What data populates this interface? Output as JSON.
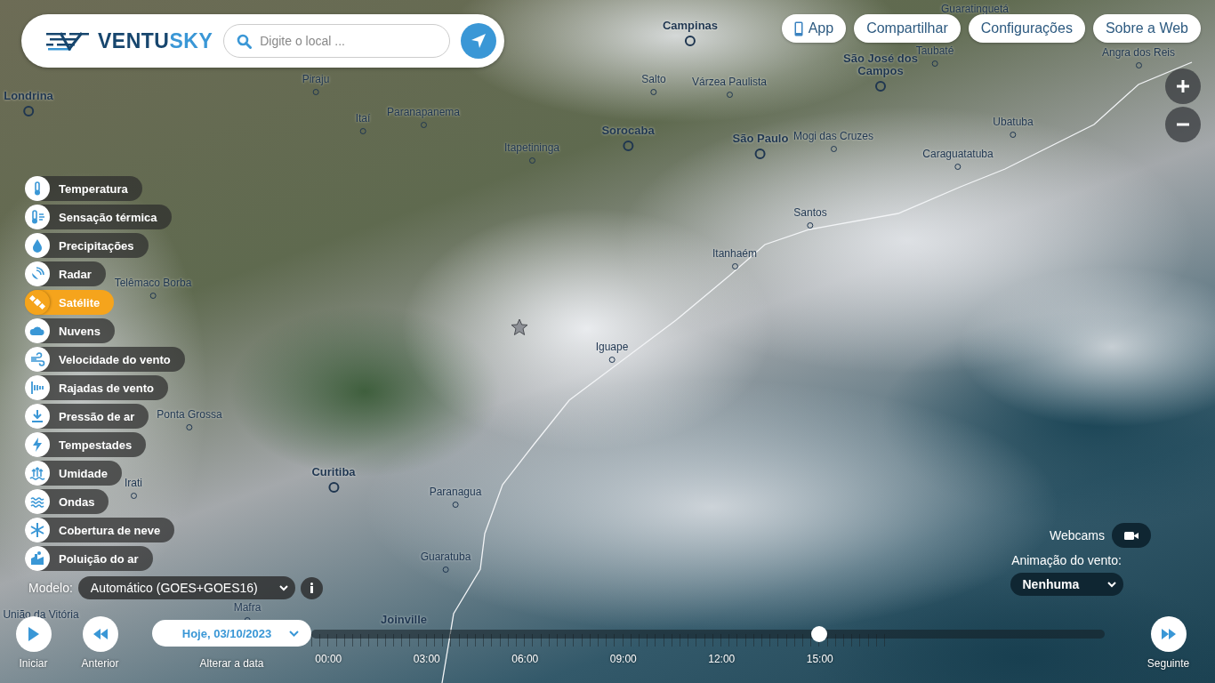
{
  "header": {
    "logo_dark": "VENTU",
    "logo_light": "SKY",
    "search": {
      "placeholder": "Digite o local ..."
    }
  },
  "top_buttons": [
    {
      "label": "App",
      "kind": "app"
    },
    {
      "label": "Compartilhar",
      "kind": "plain"
    },
    {
      "label": "Configurações",
      "kind": "plain"
    },
    {
      "label": "Sobre a Web",
      "kind": "plain"
    }
  ],
  "layers": [
    {
      "label": "Temperatura",
      "selected": false
    },
    {
      "label": "Sensação térmica",
      "selected": false
    },
    {
      "label": "Precipitações",
      "selected": false
    },
    {
      "label": "Radar",
      "selected": false
    },
    {
      "label": "Satélite",
      "selected": true
    },
    {
      "label": "Nuvens",
      "selected": false
    },
    {
      "label": "Velocidade do vento",
      "selected": false
    },
    {
      "label": "Rajadas de vento",
      "selected": false
    },
    {
      "label": "Pressão de ar",
      "selected": false
    },
    {
      "label": "Tempestades",
      "selected": false
    },
    {
      "label": "Umidade",
      "selected": false
    },
    {
      "label": "Ondas",
      "selected": false
    },
    {
      "label": "Cobertura de neve",
      "selected": false
    },
    {
      "label": "Poluição do ar",
      "selected": false
    }
  ],
  "model": {
    "label": "Modelo:",
    "value": "Automático (GOES+GOES16)"
  },
  "webcams": {
    "label": "Webcams"
  },
  "wind_animation": {
    "label": "Animação do vento:",
    "value": "Nenhuma"
  },
  "map": {
    "cities": [
      {
        "name": "Londrina",
        "major": true
      },
      {
        "name": "Piraju",
        "major": false
      },
      {
        "name": "Itaí",
        "major": false
      },
      {
        "name": "Paranapanema",
        "major": false
      },
      {
        "name": "Itapetininga",
        "major": false
      },
      {
        "name": "Sorocaba",
        "major": true
      },
      {
        "name": "Salto",
        "major": false
      },
      {
        "name": "Campinas",
        "major": true
      },
      {
        "name": "Várzea Paulista",
        "major": false
      },
      {
        "name": "São Paulo",
        "major": true
      },
      {
        "name": "Mogi das Cruzes",
        "major": false
      },
      {
        "name": "São José dos Campos",
        "major": true
      },
      {
        "name": "Taubaté",
        "major": false
      },
      {
        "name": "Guaratinguetá",
        "major": false
      },
      {
        "name": "Angra dos Reis",
        "major": false
      },
      {
        "name": "Ubatuba",
        "major": false
      },
      {
        "name": "Caraguatatuba",
        "major": false
      },
      {
        "name": "Santos",
        "major": false
      },
      {
        "name": "Itanhaém",
        "major": false
      },
      {
        "name": "Iguape",
        "major": false
      },
      {
        "name": "Telêmaco Borba",
        "major": false
      },
      {
        "name": "Ponta Grossa",
        "major": false
      },
      {
        "name": "Irati",
        "major": false
      },
      {
        "name": "Curitiba",
        "major": true
      },
      {
        "name": "Paranagua",
        "major": false
      },
      {
        "name": "Guaratuba",
        "major": false
      },
      {
        "name": "Mafra",
        "major": false
      },
      {
        "name": "União da Vitória",
        "major": false
      },
      {
        "name": "Joinville",
        "major": true
      }
    ]
  },
  "playback": [
    {
      "label": "Iniciar",
      "kind": "play"
    },
    {
      "label": "Anterior",
      "kind": "previous"
    }
  ],
  "date": {
    "value": "Hoje, 03/10/2023",
    "caption": "Alterar a data"
  },
  "timeline": {
    "level": 0.64,
    "hours": [
      "00:00",
      "03:00",
      "06:00",
      "09:00",
      "12:00",
      "15:00"
    ]
  },
  "next": {
    "label": "Seguinte"
  }
}
